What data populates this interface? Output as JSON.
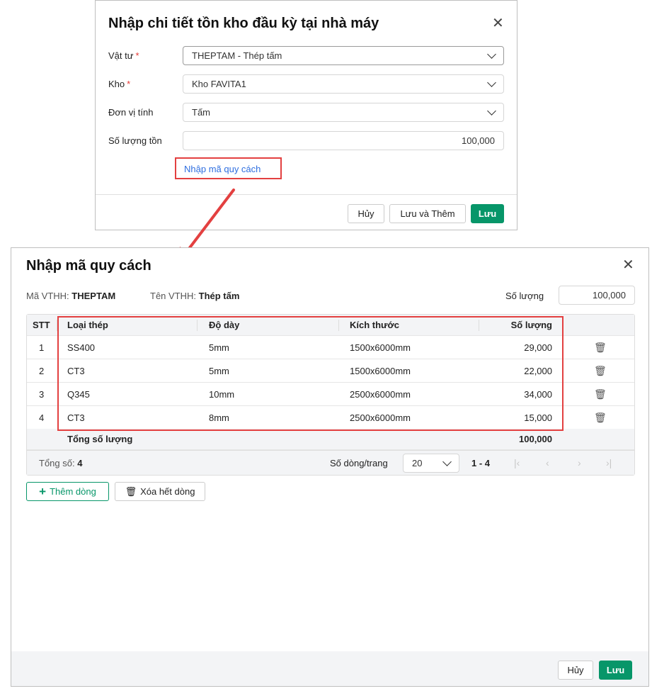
{
  "dialog1": {
    "title": "Nhập chi tiết tồn kho đầu kỳ tại nhà máy",
    "fields": [
      {
        "label": "Vật tư",
        "required": "*",
        "value": "THEPTAM - Thép tấm"
      },
      {
        "label": "Kho",
        "required": "*",
        "value": "Kho FAVITA1"
      },
      {
        "label": "Đơn vị tính",
        "value": "Tấm"
      },
      {
        "label": "Số lượng tồn",
        "value": "100,000"
      }
    ],
    "link": "Nhập mã quy cách",
    "buttons": {
      "cancel": "Hủy",
      "save_add": "Lưu và Thêm",
      "save": "Lưu"
    }
  },
  "dialog2": {
    "title": "Nhập mã quy cách",
    "ma_label": "Mã VTHH:",
    "ma_value": "THEPTAM",
    "ten_label": "Tên VTHH:",
    "ten_value": "Thép tấm",
    "qty_label": "Số lượng",
    "qty_value": "100,000",
    "columns": [
      "STT",
      "Loại thép",
      "Độ dày",
      "Kích thước",
      "Số lượng"
    ],
    "rows": [
      {
        "stt": "1",
        "loai": "SS400",
        "day": "5mm",
        "kich": "1500x6000mm",
        "sl": "29,000"
      },
      {
        "stt": "2",
        "loai": "CT3",
        "day": "5mm",
        "kich": "1500x6000mm",
        "sl": "22,000"
      },
      {
        "stt": "3",
        "loai": "Q345",
        "day": "10mm",
        "kich": "2500x6000mm",
        "sl": "34,000"
      },
      {
        "stt": "4",
        "loai": "CT3",
        "day": "8mm",
        "kich": "2500x6000mm",
        "sl": "15,000"
      }
    ],
    "total_label": "Tổng số lượng",
    "total_value": "100,000",
    "count_label": "Tổng số:",
    "count_value": "4",
    "page_size_label": "Số dòng/trang",
    "page_size": "20",
    "range": "1 - 4",
    "add_row": "Thêm dòng",
    "clear_rows": "Xóa hết dòng",
    "buttons": {
      "cancel": "Hủy",
      "save": "Lưu"
    }
  },
  "colors": {
    "primary": "#079669",
    "link": "#2f6fe0",
    "highlight": "#e34040"
  }
}
